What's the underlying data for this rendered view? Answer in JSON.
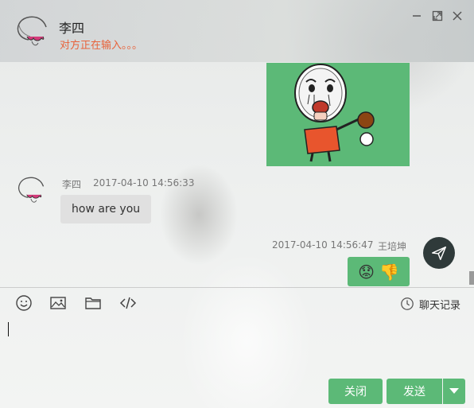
{
  "header": {
    "contact_name": "李四",
    "typing_status": "对方正在输入。。。"
  },
  "messages": [
    {
      "type": "sticker",
      "direction": "sent",
      "description": "cartoon meme sticker on green background"
    },
    {
      "type": "text",
      "direction": "received",
      "sender": "李四",
      "timestamp": "2017-04-10 14:56:33",
      "text": "how are you"
    },
    {
      "type": "emoji",
      "direction": "sent",
      "sender": "王培坤",
      "timestamp": "2017-04-10 14:56:47",
      "emojis": [
        "😟",
        "👎"
      ]
    }
  ],
  "toolbar": {
    "emoji_icon": "smiley-icon",
    "image_icon": "image-icon",
    "folder_icon": "folder-icon",
    "code_icon": "code-icon",
    "history_label": "聊天记录"
  },
  "footer": {
    "close_label": "关闭",
    "send_label": "发送"
  },
  "colors": {
    "accent_green": "#5cb977",
    "typing_orange": "#e8623a",
    "received_bubble": "#e0e0e0",
    "send_fab": "#2f3a3a"
  }
}
